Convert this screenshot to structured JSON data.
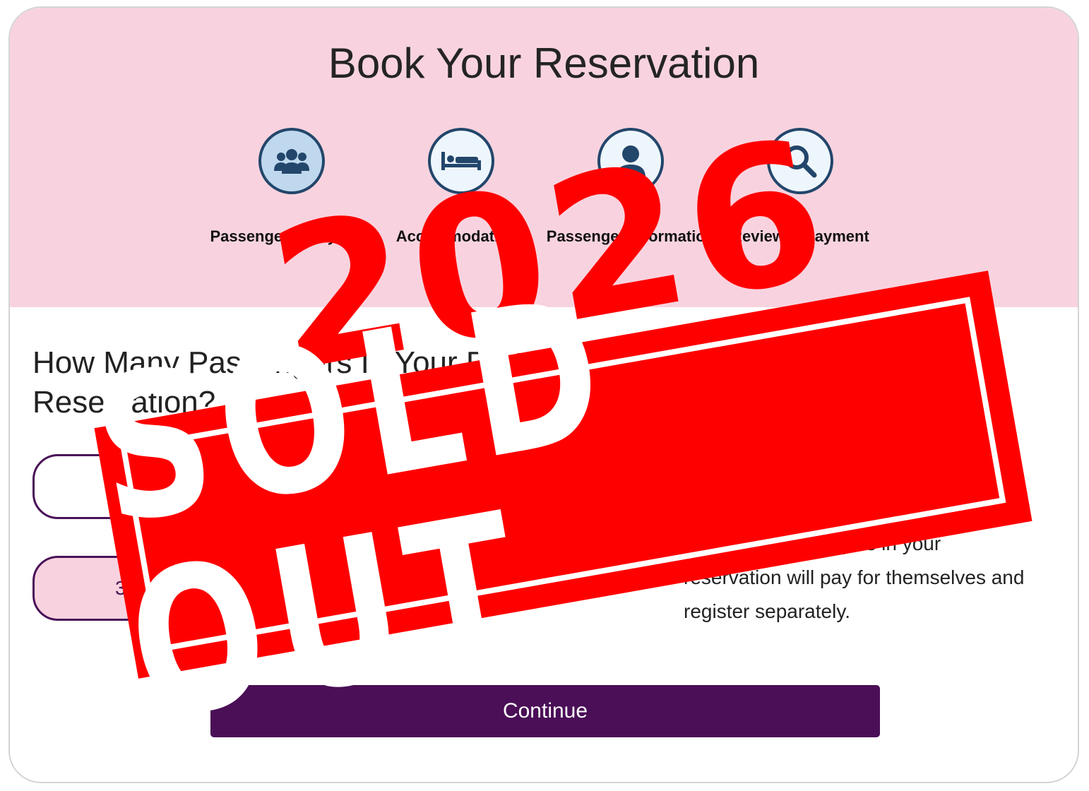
{
  "page": {
    "title": "Book Your Reservation"
  },
  "steps": [
    {
      "label": "Passenger & Payment",
      "icon": "users-icon"
    },
    {
      "label": "Accommodations",
      "icon": "bed-icon"
    },
    {
      "label": "Passenger Information",
      "icon": "user-icon"
    },
    {
      "label": "Review & Payment",
      "icon": "search-icon"
    }
  ],
  "question": "How Many Passengers In Your Party Are You Booking For Your Reservation?",
  "options": [
    {
      "label": "",
      "selected": false
    },
    {
      "label": "3",
      "selected": true
    }
  ],
  "note": "Any other passengers in your reservation will pay for themselves and register separately.",
  "continue_label": "Continue",
  "stamp": {
    "year": "2026",
    "text": "SOLD OUT"
  },
  "colors": {
    "header_bg": "#f8d3df",
    "accent": "#4a0f57",
    "icon_border": "#23466b",
    "stamp": "#ff0000"
  }
}
